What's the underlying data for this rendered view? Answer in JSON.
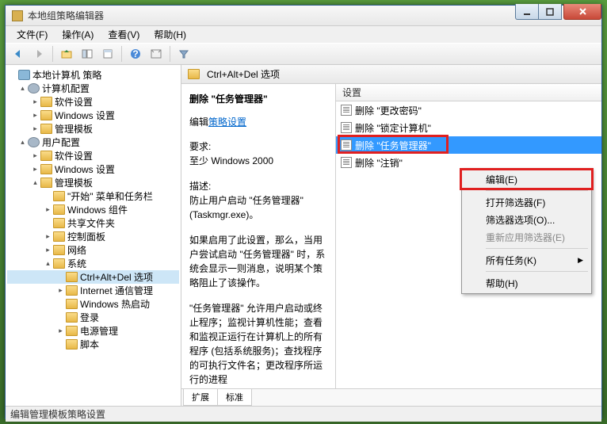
{
  "window": {
    "title": "本地组策略编辑器"
  },
  "menu": {
    "file": "文件(F)",
    "action": "操作(A)",
    "view": "查看(V)",
    "help": "帮助(H)"
  },
  "tree": {
    "root": "本地计算机 策略",
    "computer": "计算机配置",
    "user": "用户配置",
    "software": "软件设置",
    "windows_settings": "Windows 设置",
    "admin_templates": "管理模板",
    "start_menu": "\"开始\" 菜单和任务栏",
    "win_components": "Windows 组件",
    "shared_folders": "共享文件夹",
    "control_panel": "控制面板",
    "network": "网络",
    "system": "系统",
    "ctrlaltdel": "Ctrl+Alt+Del 选项",
    "internet": "Internet 通信管理",
    "win_hotstart": "Windows 热启动",
    "logon": "登录",
    "power": "电源管理",
    "script": "脚本"
  },
  "header": {
    "title": "Ctrl+Alt+Del 选项"
  },
  "desc": {
    "title": "删除 \"任务管理器\"",
    "edit_prefix": "编辑",
    "edit_link": "策略设置",
    "req_label": "要求:",
    "req_text": "至少 Windows 2000",
    "desc_label": "描述:",
    "para1": "防止用户启动 \"任务管理器\" (Taskmgr.exe)。",
    "para2": "如果启用了此设置，那么，当用户尝试启动 \"任务管理器\" 时，系统会显示一则消息，说明某个策略阻止了该操作。",
    "para3": "\"任务管理器\" 允许用户启动或终止程序；监视计算机性能；查看和监视正运行在计算机上的所有程序 (包括系统服务)；查找程序的可执行文件名；更改程序所运行的进程"
  },
  "list": {
    "header": "设置",
    "items": [
      "删除 \"更改密码\"",
      "删除 \"锁定计算机\"",
      "删除 \"任务管理器\"",
      "删除 \"注销\""
    ]
  },
  "context_menu": {
    "edit": "编辑(E)",
    "open_filter": "打开筛选器(F)",
    "filter_options": "筛选器选项(O)...",
    "reapply_filter": "重新应用筛选器(E)",
    "all_tasks": "所有任务(K)",
    "help": "帮助(H)"
  },
  "tabs": {
    "extended": "扩展",
    "standard": "标准"
  },
  "status": "编辑管理模板策略设置"
}
